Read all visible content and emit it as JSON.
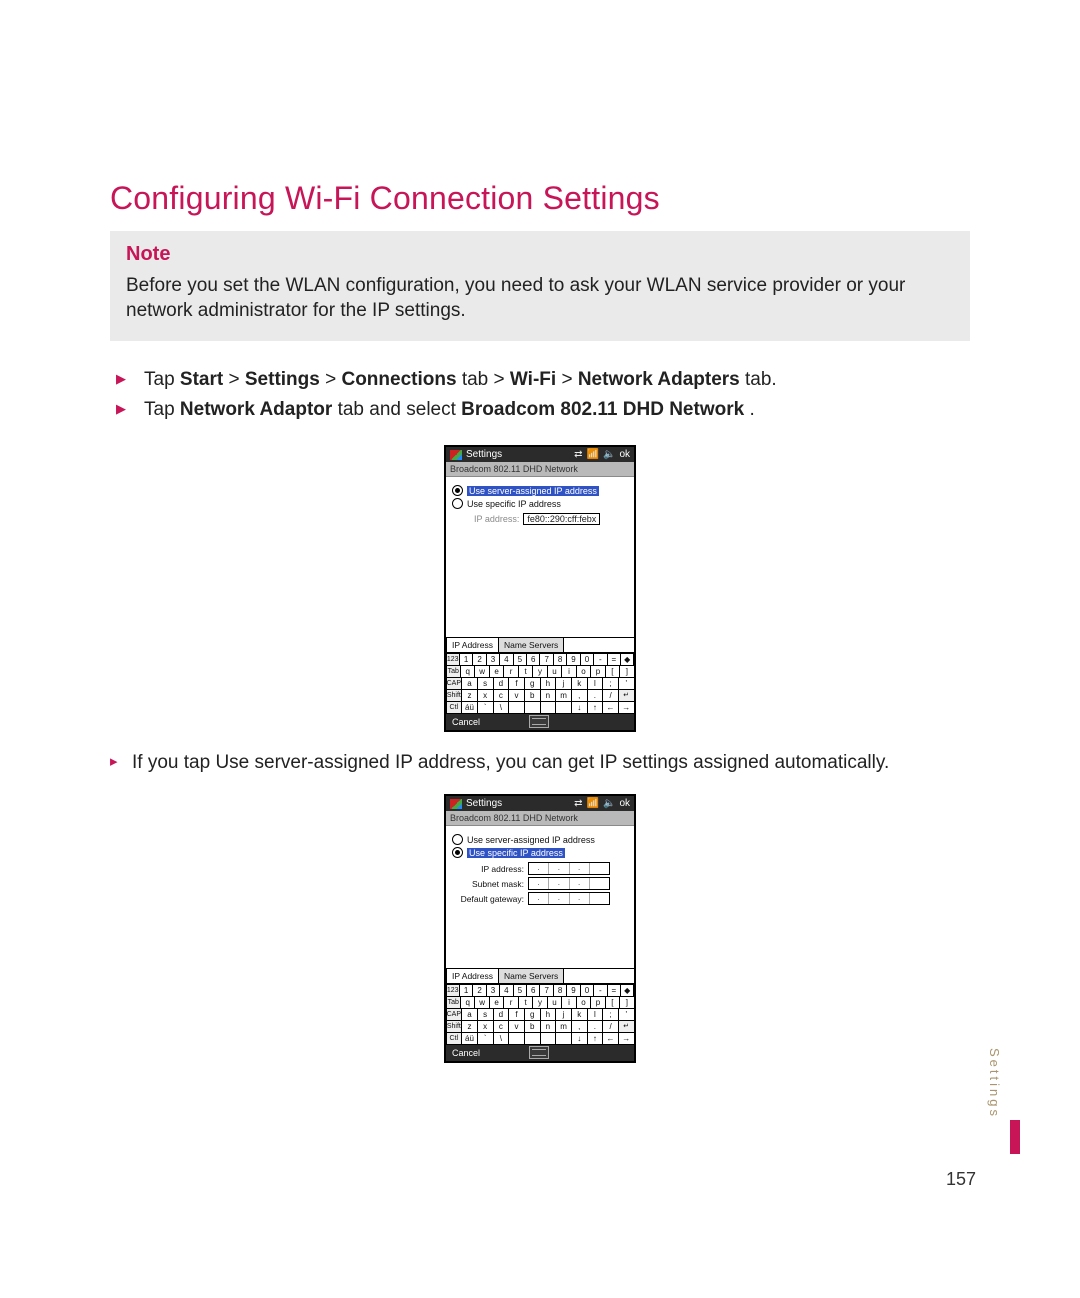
{
  "heading": "Configuring Wi-Fi Connection Settings",
  "note": {
    "title": "Note",
    "text": "Before you set the WLAN configuration, you need to ask your WLAN service provider or your network administrator for the IP settings."
  },
  "steps": {
    "s1": {
      "pre": "Tap ",
      "b1": "Start",
      "t1": " > ",
      "b2": "Settings",
      "t2": " > ",
      "b3": "Connections",
      "t3": " tab > ",
      "b4": "Wi-Fi",
      "t4": " > ",
      "b5": "Network Adapters",
      "t5": " tab."
    },
    "s2": {
      "pre": "Tap ",
      "b1": "Network Adaptor",
      "t1": " tab and select ",
      "b2": "Broadcom 802.11 DHD Network",
      "t2": "."
    }
  },
  "sub": "If you tap Use server-assigned IP address, you can get IP settings assigned automatically.",
  "screen": {
    "title": "Settings",
    "ok": "ok",
    "crumb": "Broadcom 802.11 DHD Network",
    "opt_server": "Use server-assigned IP address",
    "opt_specific": "Use specific IP address",
    "ip_label": "IP address:",
    "ip_value": "fe80::290:cff:febx",
    "subnet_label": "Subnet mask:",
    "gateway_label": "Default gateway:",
    "tab_ip": "IP Address",
    "tab_ns": "Name Servers",
    "cancel": "Cancel",
    "kbd": {
      "r0": [
        "123",
        "1",
        "2",
        "3",
        "4",
        "5",
        "6",
        "7",
        "8",
        "9",
        "0",
        "-",
        "=",
        "◆"
      ],
      "r1": [
        "Tab",
        "q",
        "w",
        "e",
        "r",
        "t",
        "y",
        "u",
        "i",
        "o",
        "p",
        "[",
        "]"
      ],
      "r2": [
        "CAP",
        "a",
        "s",
        "d",
        "f",
        "g",
        "h",
        "j",
        "k",
        "l",
        ";",
        "'"
      ],
      "r3": [
        "Shift",
        "z",
        "x",
        "c",
        "v",
        "b",
        "n",
        "m",
        ",",
        ".",
        "/",
        "↵"
      ],
      "r4": [
        "Ctl",
        "áü",
        "`",
        "\\",
        " ",
        " ",
        " ",
        " ",
        "↓",
        "↑",
        "←",
        "→"
      ]
    }
  },
  "side": "Settings",
  "page_number": "157"
}
